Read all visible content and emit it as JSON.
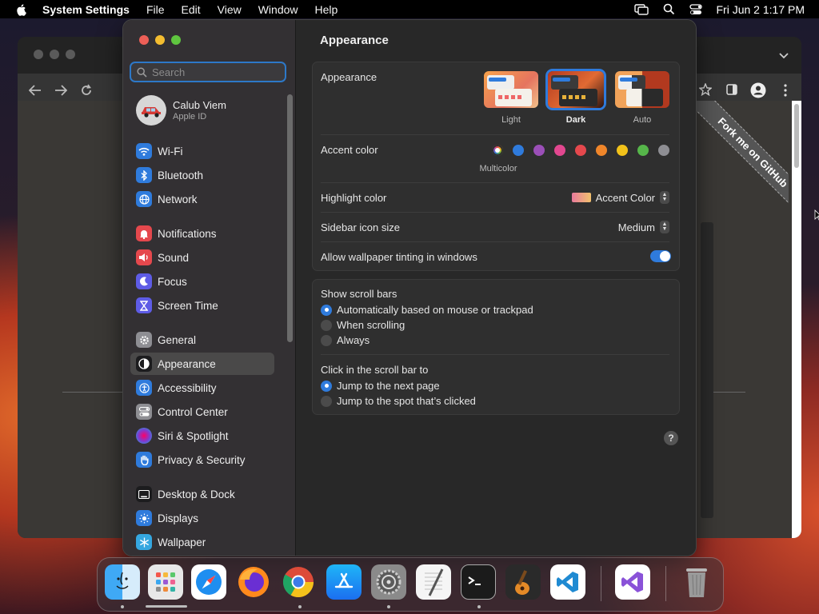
{
  "menubar": {
    "app_name": "System Settings",
    "menus": [
      "File",
      "Edit",
      "View",
      "Window",
      "Help"
    ],
    "clock": "Fri Jun 2  1:17 PM"
  },
  "browser": {
    "ribbon_text": "Fork me on GitHub"
  },
  "sidebar": {
    "search_placeholder": "Search",
    "user": {
      "name": "Calub Viem",
      "subtitle": "Apple ID"
    },
    "items": [
      {
        "label": "Wi-Fi",
        "icon": "wifi-icon",
        "color": "#2f7bdc"
      },
      {
        "label": "Bluetooth",
        "icon": "bluetooth-icon",
        "color": "#2f7bdc"
      },
      {
        "label": "Network",
        "icon": "globe-icon",
        "color": "#2f7bdc"
      },
      {
        "label": "Notifications",
        "icon": "bell-icon",
        "color": "#e5484d"
      },
      {
        "label": "Sound",
        "icon": "speaker-icon",
        "color": "#e5484d"
      },
      {
        "label": "Focus",
        "icon": "moon-icon",
        "color": "#5e5ce6"
      },
      {
        "label": "Screen Time",
        "icon": "hourglass-icon",
        "color": "#5e5ce6"
      },
      {
        "label": "General",
        "icon": "gear-icon",
        "color": "#8e8e93"
      },
      {
        "label": "Appearance",
        "icon": "appearance-icon",
        "color": "#1c1c1e"
      },
      {
        "label": "Accessibility",
        "icon": "accessibility-icon",
        "color": "#2f7bdc"
      },
      {
        "label": "Control Center",
        "icon": "switches-icon",
        "color": "#8e8e93"
      },
      {
        "label": "Siri & Spotlight",
        "icon": "siri-icon",
        "color": "#7d3bd1"
      },
      {
        "label": "Privacy & Security",
        "icon": "hand-icon",
        "color": "#2f7bdc"
      },
      {
        "label": "Desktop & Dock",
        "icon": "dock-icon",
        "color": "#1c1c1e"
      },
      {
        "label": "Displays",
        "icon": "sun-icon",
        "color": "#2f7bdc"
      },
      {
        "label": "Wallpaper",
        "icon": "snowflake-icon",
        "color": "#35a7e0"
      }
    ],
    "selected": "Appearance"
  },
  "main": {
    "title": "Appearance",
    "appearance": {
      "label": "Appearance",
      "options": [
        "Light",
        "Dark",
        "Auto"
      ],
      "selected": "Dark"
    },
    "accent": {
      "label": "Accent color",
      "selected_caption": "Multicolor",
      "colors": [
        "#2f7bdc",
        "#9b4fb8",
        "#e2478f",
        "#e5484d",
        "#f0862a",
        "#f2c21a",
        "#56b64a",
        "#8e8e93"
      ]
    },
    "highlight": {
      "label": "Highlight color",
      "value": "Accent Color"
    },
    "icon_size": {
      "label": "Sidebar icon size",
      "value": "Medium"
    },
    "tinting": {
      "label": "Allow wallpaper tinting in windows",
      "on": true
    },
    "scrollbars": {
      "label": "Show scroll bars",
      "options": [
        "Automatically based on mouse or trackpad",
        "When scrolling",
        "Always"
      ],
      "selected": 0
    },
    "click_scroll": {
      "label": "Click in the scroll bar to",
      "options": [
        "Jump to the next page",
        "Jump to the spot that’s clicked"
      ],
      "selected": 0
    },
    "help": "?"
  },
  "dock": {
    "apps": [
      "Finder",
      "Launchpad",
      "Safari",
      "Firefox",
      "Chrome",
      "App Store",
      "System Settings",
      "TextEdit",
      "Terminal",
      "GarageBand",
      "Visual Studio Code",
      "Visual Studio",
      "Trash"
    ]
  }
}
